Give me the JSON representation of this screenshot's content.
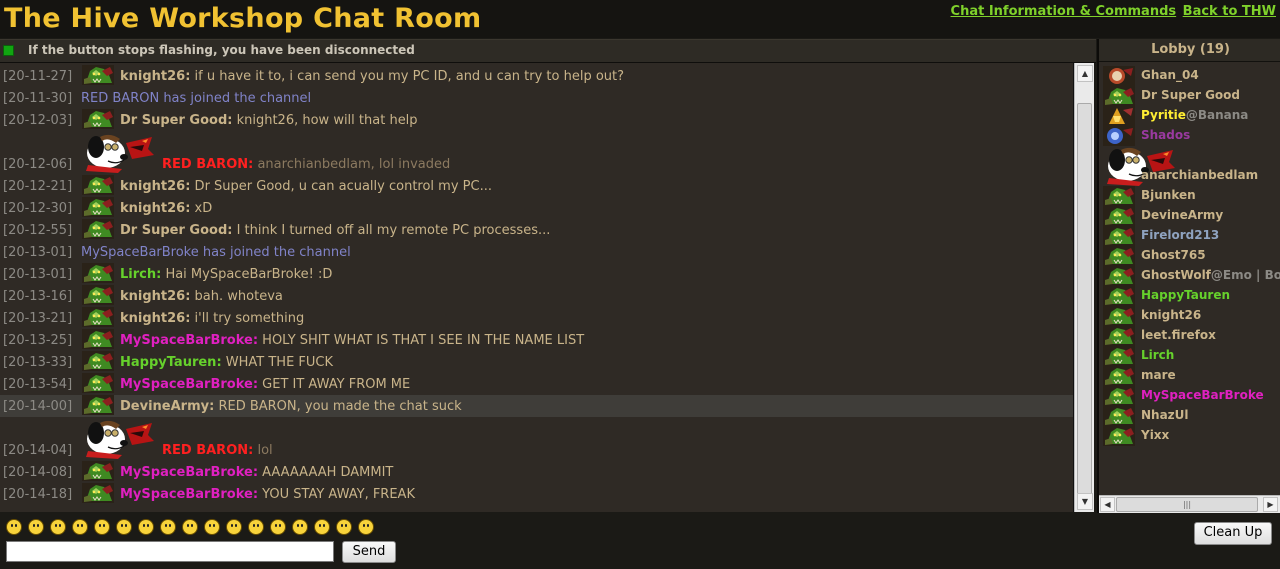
{
  "header": {
    "title": "The Hive Workshop Chat Room",
    "links": [
      {
        "label": "Chat Information & Commands"
      },
      {
        "label": "Back to THW"
      }
    ]
  },
  "status": {
    "text": "If the button stops flashing, you have been disconnected",
    "light_color": "#11a511"
  },
  "messages": [
    {
      "time": "[20-11-27]",
      "type": "chat",
      "avatar": "orc",
      "name": "knight26:",
      "name_color": "default",
      "text": " if u have it to, i can send you my PC ID, and u can try to help out?"
    },
    {
      "time": "[20-11-30]",
      "type": "join",
      "text": "RED BARON has joined the channel"
    },
    {
      "time": "[20-12-03]",
      "type": "chat",
      "avatar": "orc",
      "name": "Dr Super Good:",
      "name_color": "default",
      "text": " knight26, how will that help"
    },
    {
      "time": "[20-12-06]",
      "type": "chat",
      "avatar": "snoopy",
      "name": "RED BARON:",
      "name_color": "red",
      "text": " anarchianbedlam, lol invaded",
      "dim": true
    },
    {
      "time": "[20-12-21]",
      "type": "chat",
      "avatar": "orc",
      "name": "knight26:",
      "name_color": "default",
      "text": " Dr Super Good, u can acually control my PC..."
    },
    {
      "time": "[20-12-30]",
      "type": "chat",
      "avatar": "orc",
      "name": "knight26:",
      "name_color": "default",
      "text": " xD"
    },
    {
      "time": "[20-12-55]",
      "type": "chat",
      "avatar": "orc",
      "name": "Dr Super Good:",
      "name_color": "default",
      "text": " I think I turned off all my remote PC processes..."
    },
    {
      "time": "[20-13-01]",
      "type": "join",
      "text": "MySpaceBarBroke has joined the channel"
    },
    {
      "time": "[20-13-01]",
      "type": "chat",
      "avatar": "orc",
      "name": "Lirch:",
      "name_color": "green",
      "text": " Hai MySpaceBarBroke! :D"
    },
    {
      "time": "[20-13-16]",
      "type": "chat",
      "avatar": "orc",
      "name": "knight26:",
      "name_color": "default",
      "text": " bah. whoteva"
    },
    {
      "time": "[20-13-21]",
      "type": "chat",
      "avatar": "orc",
      "name": "knight26:",
      "name_color": "default",
      "text": " i'll try something"
    },
    {
      "time": "[20-13-25]",
      "type": "chat",
      "avatar": "orc",
      "name": "MySpaceBarBroke:",
      "name_color": "magenta",
      "text": " HOLY SHIT WHAT IS THAT I SEE IN THE NAME LIST"
    },
    {
      "time": "[20-13-33]",
      "type": "chat",
      "avatar": "orc",
      "name": "HappyTauren:",
      "name_color": "green",
      "text": " WHAT THE FUCK"
    },
    {
      "time": "[20-13-54]",
      "type": "chat",
      "avatar": "orc",
      "name": "MySpaceBarBroke:",
      "name_color": "magenta",
      "text": " GET IT AWAY FROM ME"
    },
    {
      "time": "[20-14-00]",
      "type": "chat",
      "avatar": "orc",
      "name": "DevineArmy:",
      "name_color": "default",
      "text": " RED BARON, you made the chat suck",
      "highlight": true
    },
    {
      "time": "[20-14-04]",
      "type": "chat",
      "avatar": "snoopy",
      "name": "RED BARON:",
      "name_color": "red",
      "text": " lol",
      "dim": true
    },
    {
      "time": "[20-14-08]",
      "type": "chat",
      "avatar": "orc",
      "name": "MySpaceBarBroke:",
      "name_color": "magenta",
      "text": " AAAAAAAH DAMMIT"
    },
    {
      "time": "[20-14-18]",
      "type": "chat",
      "avatar": "orc",
      "name": "MySpaceBarBroke:",
      "name_color": "magenta",
      "text": " YOU STAY AWAY, FREAK"
    }
  ],
  "lobby": {
    "header": "Lobby (19)",
    "users": [
      {
        "name": "Ghan_04",
        "color": "default",
        "avatar": "warrior"
      },
      {
        "name": "Dr Super Good",
        "color": "default",
        "avatar": "orc"
      },
      {
        "name": "Pyritie",
        "extra": "@Banana",
        "color": "yellow",
        "avatar": "mage"
      },
      {
        "name": "Shados",
        "color": "purple",
        "avatar": "blue"
      },
      {
        "name": "anarchianbedlam",
        "color": "default",
        "avatar": "snoopy"
      },
      {
        "name": "Bjunken",
        "color": "default",
        "avatar": "orc"
      },
      {
        "name": "DevineArmy",
        "color": "default",
        "avatar": "orc"
      },
      {
        "name": "Firelord213",
        "color": "blue",
        "avatar": "orc"
      },
      {
        "name": "Ghost765",
        "color": "default",
        "avatar": "orc"
      },
      {
        "name": "GhostWolf",
        "extra": "@Emo | Bot",
        "color": "default",
        "avatar": "orc"
      },
      {
        "name": "HappyTauren",
        "color": "green",
        "avatar": "orc"
      },
      {
        "name": "knight26",
        "color": "default",
        "avatar": "orc"
      },
      {
        "name": "leet.firefox",
        "color": "default",
        "avatar": "orc"
      },
      {
        "name": "Lirch",
        "color": "green",
        "avatar": "orc"
      },
      {
        "name": "mare",
        "color": "default",
        "avatar": "orc"
      },
      {
        "name": "MySpaceBarBroke",
        "color": "magenta",
        "avatar": "orc"
      },
      {
        "name": "NhazUl",
        "color": "default",
        "avatar": "orc"
      },
      {
        "name": "Yixx",
        "color": "default",
        "avatar": "orc"
      }
    ]
  },
  "emoticons": [
    "biggrin",
    "smile",
    "cool",
    "frown",
    "grin",
    "confused",
    "redface",
    "eek",
    "wink",
    "rolleyes",
    "mad",
    "exclaim",
    "question",
    "lol",
    "razz",
    "hmm",
    "cry"
  ],
  "input": {
    "value": "",
    "placeholder": ""
  },
  "buttons": {
    "send": "Send",
    "clean_up": "Clean Up"
  },
  "scrollbar_glyphs": {
    "up": "▲",
    "down": "▼",
    "left": "◀",
    "right": "▶",
    "grip": "|||"
  }
}
